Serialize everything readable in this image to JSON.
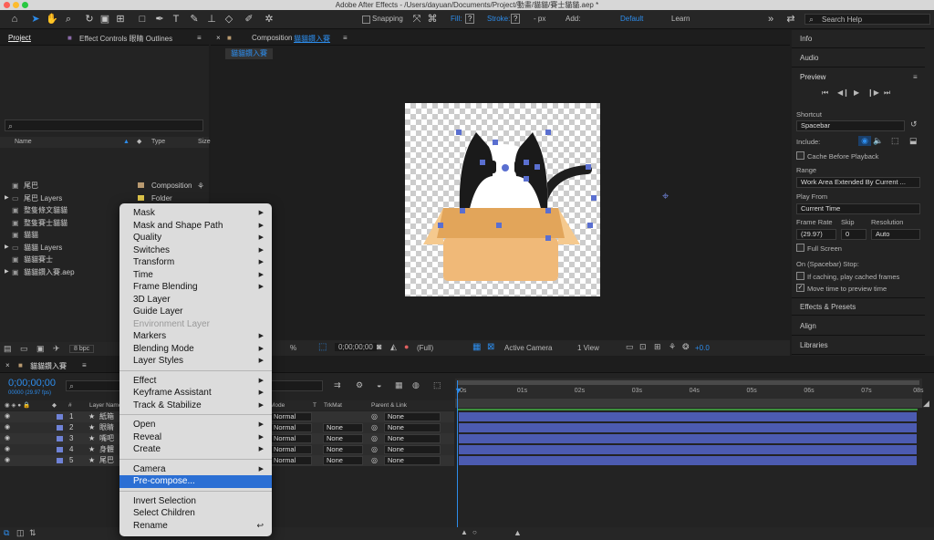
{
  "window": {
    "title": "Adobe After Effects - /Users/dayuan/Documents/Project/動畫/貓貓/賽士貓貓.aep *"
  },
  "toolbar": {
    "snapping": "Snapping",
    "fill_label": "Fill:",
    "fill_value": "?",
    "stroke_label": "Stroke:",
    "stroke_value": "?",
    "px": "- px",
    "add_label": "Add:",
    "workspace_default": "Default",
    "workspace_learn": "Learn",
    "search_placeholder": "Search Help"
  },
  "project_panel": {
    "tabs": [
      "Project",
      "Effect Controls 眼睛 Outlines"
    ],
    "columns": {
      "name": "Name",
      "type": "Type",
      "size": "Size"
    },
    "items": [
      {
        "name": "尾巴",
        "type": "Composition",
        "color": "#b99a70"
      },
      {
        "name": "尾巴 Layers",
        "type": "Folder",
        "color": "#e0c64a"
      },
      {
        "name": "整隻條文貓貓",
        "type": "Composition",
        "color": "#b99a70"
      },
      {
        "name": "整隻賽士貓貓",
        "type": "Composition",
        "color": "#b99a70"
      },
      {
        "name": "貓貓",
        "type": "Composition",
        "color": "#b99a70"
      },
      {
        "name": "貓貓 Layers",
        "type": "",
        "color": "#e0c64a"
      },
      {
        "name": "貓貓賽士",
        "type": "",
        "color": "#b99a70"
      },
      {
        "name": "貓貓鑽入賽.aep",
        "type": "",
        "color": "#8a8a8a"
      }
    ],
    "bpc": "8 bpc"
  },
  "context_menu": {
    "items": [
      {
        "label": "Mask",
        "submenu": true
      },
      {
        "label": "Mask and Shape Path",
        "submenu": true
      },
      {
        "label": "Quality",
        "submenu": true
      },
      {
        "label": "Switches",
        "submenu": true
      },
      {
        "label": "Transform",
        "submenu": true
      },
      {
        "label": "Time",
        "submenu": true
      },
      {
        "label": "Frame Blending",
        "submenu": true
      },
      {
        "label": "3D Layer"
      },
      {
        "label": "Guide Layer"
      },
      {
        "label": "Environment Layer",
        "disabled": true
      },
      {
        "label": "Markers",
        "submenu": true
      },
      {
        "label": "Blending Mode",
        "submenu": true
      },
      {
        "label": "Layer Styles",
        "submenu": true
      },
      {
        "label": "Effect",
        "submenu": true
      },
      {
        "label": "Keyframe Assistant",
        "submenu": true
      },
      {
        "label": "Track & Stabilize",
        "submenu": true
      },
      {
        "label": "Open",
        "submenu": true
      },
      {
        "label": "Reveal",
        "submenu": true
      },
      {
        "label": "Create",
        "submenu": true
      },
      {
        "label": "Camera",
        "submenu": true
      },
      {
        "label": "Pre-compose...",
        "selected": true
      },
      {
        "label": "Invert Selection"
      },
      {
        "label": "Select Children"
      },
      {
        "label": "Rename",
        "shortcut": "↩"
      }
    ]
  },
  "composition": {
    "tab_label": "Composition",
    "tab_name": "貓貓鑽入賽",
    "breadcrumb": "貓貓鑽入賽",
    "zoom": "%",
    "timecode": "0;00;00;00",
    "resolution": "(Full)",
    "camera": "Active Camera",
    "view": "1 View",
    "exposure": "+0.0"
  },
  "right_panels": {
    "info": "Info",
    "audio": "Audio",
    "preview": "Preview",
    "shortcut_label": "Shortcut",
    "shortcut_value": "Spacebar",
    "include_label": "Include:",
    "cache_before_playback": "Cache Before Playback",
    "range_label": "Range",
    "range_value": "Work Area Extended By Current ...",
    "play_from_label": "Play From",
    "play_from_value": "Current Time",
    "frame_rate_label": "Frame Rate",
    "frame_rate_value": "(29.97)",
    "skip_label": "Skip",
    "skip_value": "0",
    "resolution_label": "Resolution",
    "resolution_value": "Auto",
    "full_screen": "Full Screen",
    "on_stop_label": "On (Spacebar) Stop:",
    "if_caching": "If caching, play cached frames",
    "move_time": "Move time to preview time",
    "effects_presets": "Effects & Presets",
    "align": "Align",
    "libraries": "Libraries"
  },
  "timeline": {
    "tab_name": "貓貓鑽入賽",
    "timecode": "0;00;00;00",
    "fps": "00000 (29.97 fps)",
    "columns": {
      "num": "#",
      "layer_name": "Layer Name",
      "mode": "Mode",
      "t": "T",
      "trkmat": "TrkMat",
      "parent": "Parent & Link"
    },
    "layers": [
      {
        "num": "1",
        "name": "紙箱",
        "mode": "Normal",
        "trkmat": "",
        "parent": "None"
      },
      {
        "num": "2",
        "name": "眼睛",
        "mode": "Normal",
        "trkmat": "None",
        "parent": "None"
      },
      {
        "num": "3",
        "name": "嘴吧",
        "mode": "Normal",
        "trkmat": "None",
        "parent": "None"
      },
      {
        "num": "4",
        "name": "身體",
        "mode": "Normal",
        "trkmat": "None",
        "parent": "None"
      },
      {
        "num": "5",
        "name": "尾巴",
        "mode": "Normal",
        "trkmat": "None",
        "parent": "None"
      }
    ],
    "ruler": [
      "0s",
      "01s",
      "02s",
      "03s",
      "04s",
      "05s",
      "06s",
      "07s",
      "08s"
    ]
  }
}
